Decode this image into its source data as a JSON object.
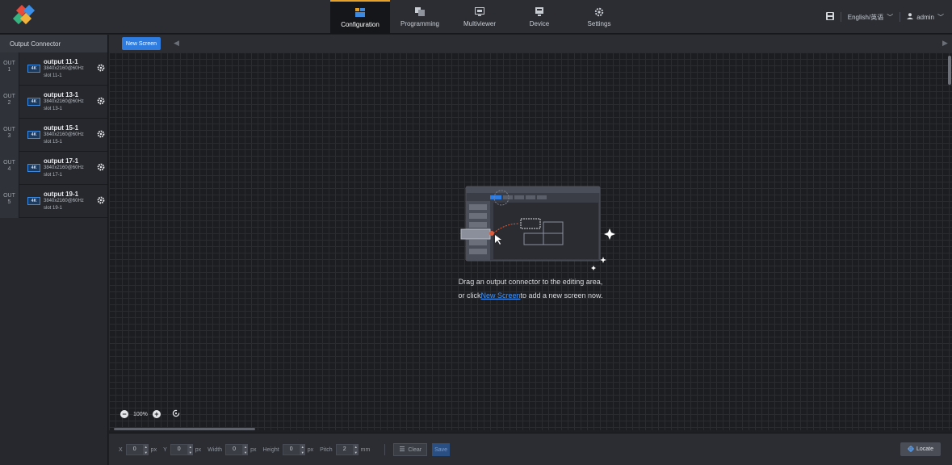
{
  "nav": {
    "tabs": [
      {
        "label": "Configuration",
        "icon": "configuration-icon"
      },
      {
        "label": "Programming",
        "icon": "programming-icon"
      },
      {
        "label": "Multiviewer",
        "icon": "multiviewer-icon"
      },
      {
        "label": "Device",
        "icon": "device-icon"
      },
      {
        "label": "Settings",
        "icon": "settings-icon"
      }
    ],
    "active_tab": "Configuration"
  },
  "topright": {
    "language": "English/英语",
    "user": "admin"
  },
  "sidebar": {
    "title": "Output Connector",
    "connectors": [
      {
        "out": "OUT",
        "num": "1",
        "badge": "4K",
        "name": "output 11-1",
        "resolution": "3840x2160@60Hz",
        "slot": "slot 11-1"
      },
      {
        "out": "OUT",
        "num": "2",
        "badge": "4K",
        "name": "output 13-1",
        "resolution": "3840x2160@60Hz",
        "slot": "slot 13-1"
      },
      {
        "out": "OUT",
        "num": "3",
        "badge": "4K",
        "name": "output 15-1",
        "resolution": "3840x2160@60Hz",
        "slot": "slot 15-1"
      },
      {
        "out": "OUT",
        "num": "4",
        "badge": "4K",
        "name": "output 17-1",
        "resolution": "3840x2160@60Hz",
        "slot": "slot 17-1"
      },
      {
        "out": "OUT",
        "num": "5",
        "badge": "4K",
        "name": "output 19-1",
        "resolution": "3840x2160@60Hz",
        "slot": "slot 19-1"
      }
    ]
  },
  "toolbar": {
    "new_screen_label": "New Screen"
  },
  "canvas": {
    "empty_line1": "Drag an output connector to the editing area,",
    "empty_line2_prefix": "or click",
    "empty_line2_link": "New Screen",
    "empty_line2_suffix": "to add a new screen now.",
    "zoom": "100%"
  },
  "bottombar": {
    "fields": [
      {
        "label": "X",
        "value": "0",
        "unit": "px"
      },
      {
        "label": "Y",
        "value": "0",
        "unit": "px"
      },
      {
        "label": "Width",
        "value": "0",
        "unit": "px"
      },
      {
        "label": "Height",
        "value": "0",
        "unit": "px"
      },
      {
        "label": "Pitch",
        "value": "2",
        "unit": "mm"
      }
    ],
    "clear_label": "Clear",
    "save_label": "Save",
    "locate_label": "Locate"
  },
  "colors": {
    "accent": "#2f7ce0",
    "active_tab_border": "#e5a12a",
    "link": "#3d95ff"
  }
}
